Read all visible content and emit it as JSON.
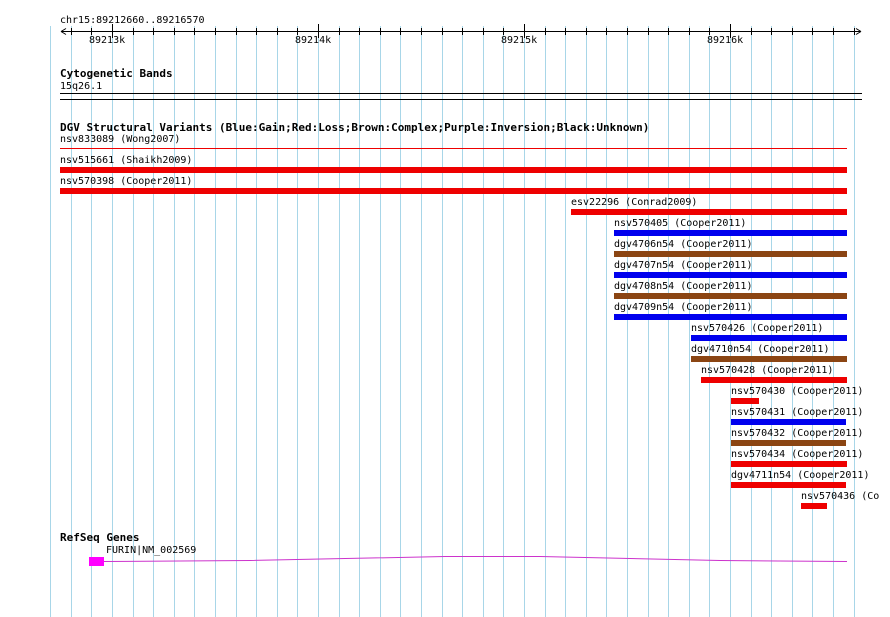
{
  "ruler": {
    "range_label": "chr15:89212660..89216570",
    "ticks": [
      {
        "label": "89213k",
        "pos": 89213000
      },
      {
        "label": "89214k",
        "pos": 89214000
      },
      {
        "label": "89215k",
        "pos": 89215000
      },
      {
        "label": "89216k",
        "pos": 89216000
      }
    ]
  },
  "cytoband": {
    "title": "Cytogenetic Bands",
    "band": "15q26.1"
  },
  "dgv": {
    "title": "DGV Structural Variants (Blue:Gain;Red:Loss;Brown:Complex;Purple:Inversion;Black:Unknown)",
    "colors": {
      "gain": "#0000ee",
      "loss": "#ee0000",
      "complex": "#8b4513",
      "thin_loss": "#ee0000"
    },
    "features": [
      {
        "label": "nsv833089 (Wong2007)",
        "type": "thin_loss",
        "start": 89212660,
        "end": 89216570
      },
      {
        "label": "nsv515661 (Shaikh2009)",
        "type": "loss",
        "start": 89212660,
        "end": 89216570
      },
      {
        "label": "nsv570398 (Cooper2011)",
        "type": "loss",
        "start": 89212660,
        "end": 89216570
      },
      {
        "label": "esv22296 (Conrad2009)",
        "type": "loss",
        "start": 89215230,
        "end": 89216570
      },
      {
        "label": "nsv570405 (Cooper2011)",
        "type": "gain",
        "start": 89215435,
        "end": 89216570
      },
      {
        "label": "dgv4706n54 (Cooper2011)",
        "type": "complex",
        "start": 89215435,
        "end": 89216570
      },
      {
        "label": "dgv4707n54 (Cooper2011)",
        "type": "gain",
        "start": 89215435,
        "end": 89216570
      },
      {
        "label": "dgv4708n54 (Cooper2011)",
        "type": "complex",
        "start": 89215435,
        "end": 89216570
      },
      {
        "label": "dgv4709n54 (Cooper2011)",
        "type": "gain",
        "start": 89215435,
        "end": 89216570
      },
      {
        "label": "nsv570426 (Cooper2011)",
        "type": "gain",
        "start": 89215810,
        "end": 89216570
      },
      {
        "label": "dgv4710n54 (Cooper2011)",
        "type": "complex",
        "start": 89215810,
        "end": 89216570
      },
      {
        "label": "nsv570428 (Cooper2011)",
        "type": "loss",
        "start": 89215860,
        "end": 89216570
      },
      {
        "label": "nsv570430 (Cooper2011)",
        "type": "loss",
        "start": 89216005,
        "end": 89216140
      },
      {
        "label": "nsv570431 (Cooper2011)",
        "type": "gain",
        "start": 89216005,
        "end": 89216565
      },
      {
        "label": "nsv570432 (Cooper2011)",
        "type": "complex",
        "start": 89216005,
        "end": 89216565
      },
      {
        "label": "nsv570434 (Cooper2011)",
        "type": "loss",
        "start": 89216005,
        "end": 89216570
      },
      {
        "label": "dgv4711n54 (Cooper2011)",
        "type": "loss",
        "start": 89216005,
        "end": 89216565
      },
      {
        "label": "nsv570436 (Co",
        "type": "loss",
        "start": 89216345,
        "end": 89216470
      }
    ]
  },
  "refseq": {
    "title": "RefSeq Genes",
    "gene_label": "FURIN|NM_002569",
    "exon_color": "#ff00ff",
    "intron_color": "#cc33cc",
    "exon_start": 89212890,
    "exon_end": 89212960,
    "intron_end": 89216570
  }
}
